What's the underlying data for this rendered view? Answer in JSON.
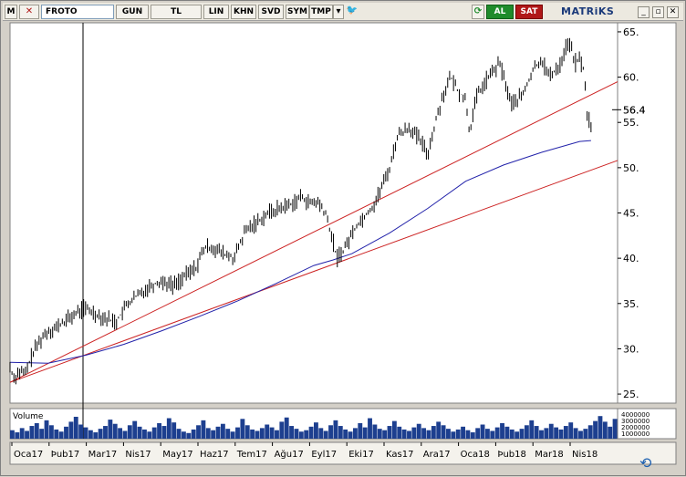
{
  "toolbar": {
    "logo": "M",
    "symbol": "FROTO",
    "period": "GUN",
    "currency": "TL",
    "scale": "LIN",
    "btn_khn": "KHN",
    "btn_svd": "SVD",
    "btn_sym": "SYM",
    "btn_tmp": "TMP",
    "buy_label": "AL",
    "sell_label": "SAT",
    "brand": "MATRiKS",
    "icons": [
      "dropdown-arrow-icon",
      "twitter-icon",
      "refresh-icon",
      "clock-icon",
      "minimize-icon",
      "restore-icon",
      "close-icon"
    ]
  },
  "colors": {
    "price": "#000000",
    "moving_average": "#2222aa",
    "trend_lines": "#cc2222",
    "volume": "#1d3f8f",
    "background": "#ffffff"
  },
  "chart_data": {
    "type": "line",
    "price_axis": {
      "ticks": [
        "65.",
        "60.",
        "56.4",
        "55.",
        "50.",
        "45.",
        "40.",
        "35.",
        "30.",
        "25."
      ],
      "ylim": [
        24,
        66
      ]
    },
    "current_price": 56.4,
    "x_ticks": [
      "Oca17",
      "Þub17",
      "Mar17",
      "Nis17",
      "May17",
      "Haz17",
      "Tem17",
      "Ağu17",
      "Eyl17",
      "Eki17",
      "Kas17",
      "Ara17",
      "Oca18",
      "Þub18",
      "Mar18",
      "Nis18"
    ],
    "price_series": {
      "x": [
        0,
        0.1,
        0.25,
        0.4,
        0.6,
        0.8,
        1.0,
        1.2,
        1.4,
        1.7,
        1.95,
        2.2,
        2.5,
        2.8,
        3.1,
        3.4,
        3.7,
        4.0,
        4.3,
        4.6,
        4.9,
        5.1,
        5.3,
        5.6,
        5.9,
        6.2,
        6.5,
        6.8,
        7.1,
        7.4,
        7.7,
        7.9,
        8.1,
        8.3,
        8.5,
        8.6,
        8.8,
        9.1,
        9.4,
        9.6,
        9.8,
        10.0,
        10.2,
        10.5,
        10.8,
        11.0,
        11.2,
        11.4,
        11.6,
        11.8,
        12.0,
        12.1,
        12.3,
        12.6,
        12.9,
        13.2,
        13.5,
        13.8,
        14.0,
        14.2,
        14.5,
        14.7,
        14.9,
        15.0,
        15.1,
        15.2,
        15.3
      ],
      "y": [
        28.0,
        26.8,
        27.5,
        27.2,
        29.5,
        31.0,
        32.0,
        32.3,
        32.9,
        33.8,
        34.5,
        34.0,
        33.4,
        33.0,
        35.0,
        36.0,
        37.0,
        37.5,
        37.0,
        38.0,
        39.0,
        41.0,
        41.3,
        40.5,
        40.0,
        43.0,
        44.0,
        45.0,
        45.5,
        46.0,
        46.8,
        46.0,
        46.2,
        45.0,
        42.0,
        40.0,
        41.0,
        43.5,
        45.0,
        46.0,
        48.0,
        50.0,
        53.5,
        54.5,
        53.0,
        51.5,
        55.0,
        58.0,
        60.0,
        58.5,
        57.5,
        54.0,
        58.0,
        60.0,
        61.5,
        57.0,
        58.0,
        61.0,
        62.0,
        60.0,
        61.5,
        64.0,
        61.5,
        62.0,
        61.0,
        56.0,
        54.5
      ]
    },
    "moving_average": {
      "x": [
        0,
        1,
        2,
        3,
        4,
        5,
        6,
        7,
        8,
        8.5,
        9,
        10,
        11,
        12,
        13,
        14,
        15,
        15.3
      ],
      "y": [
        28.5,
        28.4,
        29.3,
        30.5,
        32.0,
        33.6,
        35.3,
        37.2,
        39.2,
        39.8,
        40.5,
        42.8,
        45.5,
        48.5,
        50.3,
        51.7,
        52.9,
        53.0
      ]
    },
    "trend_lines": [
      {
        "x": [
          0,
          16
        ],
        "y": [
          26.3,
          59.5
        ]
      },
      {
        "x": [
          0,
          16
        ],
        "y": [
          26.3,
          50.8
        ]
      }
    ],
    "volume_panel": {
      "label": "Volume",
      "axis_labels": [
        "4000000",
        "3000000",
        "2000000",
        "1000000"
      ],
      "values": [
        1.2,
        0.9,
        1.5,
        1.1,
        1.8,
        2.2,
        1.4,
        2.6,
        1.9,
        1.3,
        1.0,
        1.7,
        2.4,
        3.1,
        2.0,
        1.6,
        1.2,
        0.9,
        1.4,
        1.8,
        2.7,
        2.1,
        1.5,
        1.1,
        1.9,
        2.5,
        1.7,
        1.3,
        1.0,
        1.6,
        2.2,
        1.8,
        2.9,
        2.3,
        1.4,
        1.0,
        0.8,
        1.3,
        1.9,
        2.6,
        1.5,
        1.2,
        1.7,
        2.1,
        1.4,
        1.0,
        1.6,
        2.8,
        1.9,
        1.3,
        1.1,
        1.5,
        2.0,
        1.6,
        1.2,
        2.4,
        3.0,
        1.8,
        1.4,
        1.0,
        1.2,
        1.7,
        2.3,
        1.5,
        1.1,
        1.9,
        2.6,
        1.8,
        1.3,
        1.0,
        1.5,
        2.2,
        1.6,
        2.9,
        2.0,
        1.4,
        1.2,
        1.8,
        2.5,
        1.7,
        1.3,
        1.1,
        1.6,
        2.1,
        1.5,
        1.2,
        1.8,
        2.4,
        1.9,
        1.4,
        1.0,
        1.3,
        1.7,
        1.2,
        0.9,
        1.5,
        2.0,
        1.4,
        1.1,
        1.6,
        2.2,
        1.7,
        1.3,
        1.0,
        1.4,
        1.9,
        2.6,
        1.8,
        1.2,
        1.5,
        2.1,
        1.6,
        1.3,
        1.8,
        2.3,
        1.5,
        1.1,
        1.4,
        1.9,
        2.5,
        3.2,
        2.4,
        1.7,
        2.8
      ]
    }
  }
}
